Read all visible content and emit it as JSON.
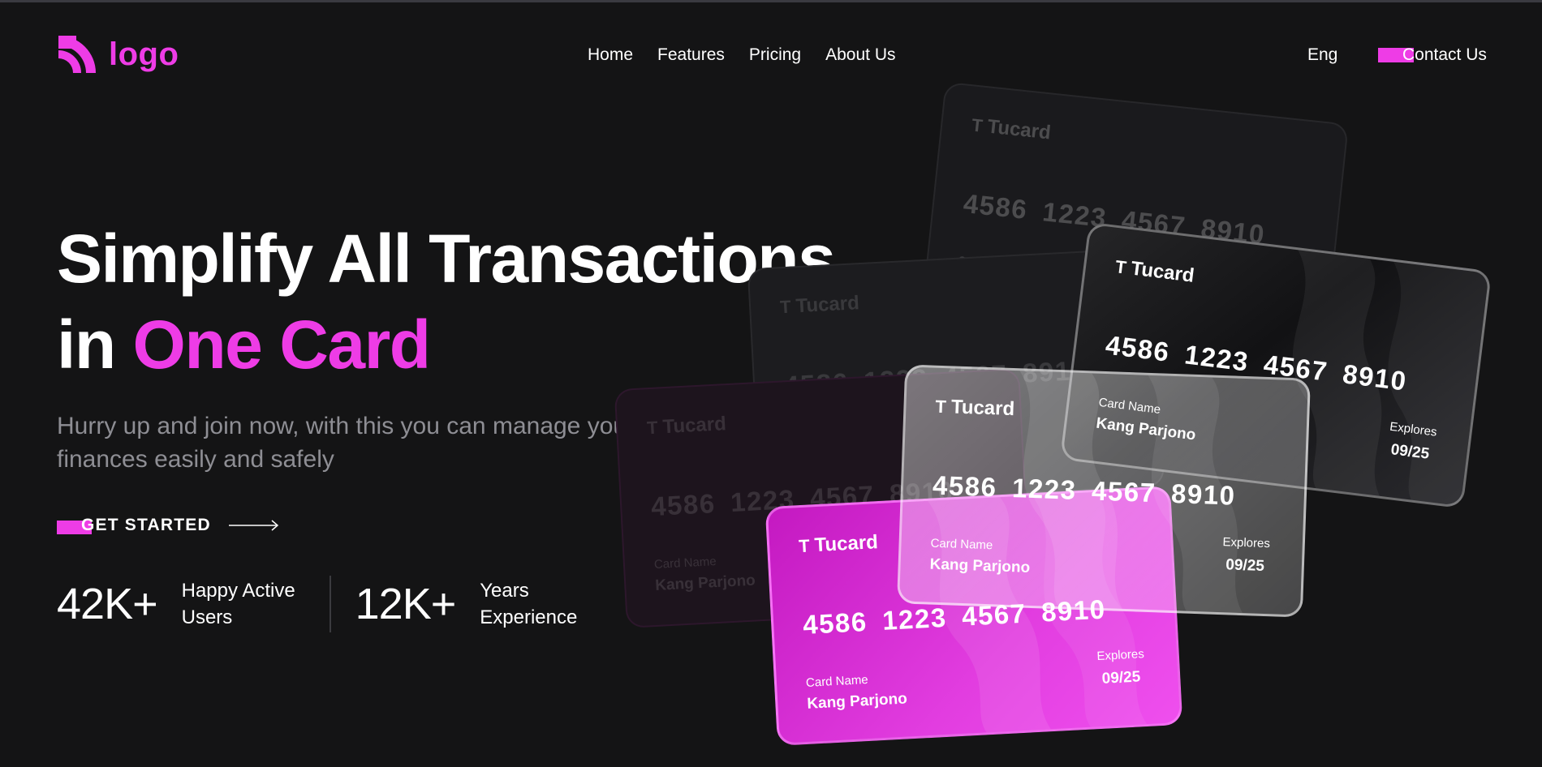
{
  "header": {
    "logo_text": "logo",
    "nav": [
      "Home",
      "Features",
      "Pricing",
      "About Us"
    ],
    "language": "Eng",
    "contact_label": "Contact Us"
  },
  "hero": {
    "title_line1": "Simplify All Transactions",
    "title_line2_prefix": "in ",
    "title_line2_accent": "One Card",
    "subtitle": "Hurry up and join now, with this you can manage your daily finances easily and safely",
    "cta_label": "GET STARTED"
  },
  "stats": [
    {
      "value": "42K+",
      "label": "Happy Active Users"
    },
    {
      "value": "12K+",
      "label": "Years Experience"
    }
  ],
  "card": {
    "brand": "Tucard",
    "brand_initial": "T",
    "number": "4586 1223 4567 8910",
    "name_label": "Card Name",
    "name": "Kang Parjono",
    "expiry_label": "Explores",
    "expiry": "09/25"
  },
  "colors": {
    "accent": "#ee3ce6",
    "background": "#141415"
  },
  "icons": {
    "logo": "signal-arcs-icon",
    "cta": "arrow-right-icon"
  }
}
